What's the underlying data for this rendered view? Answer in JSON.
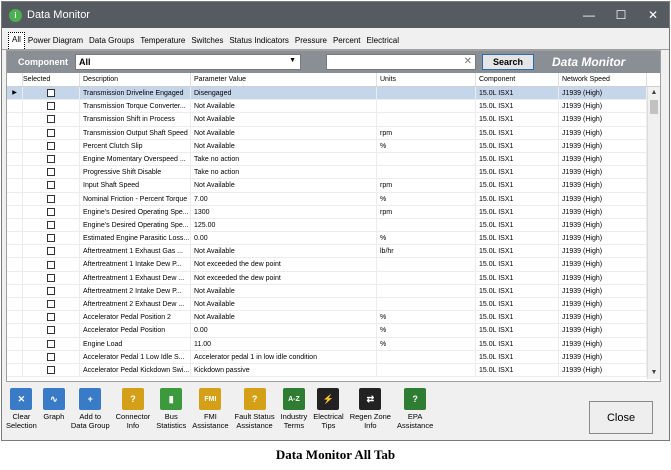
{
  "window": {
    "title": "Data Monitor",
    "icon_letter": "i"
  },
  "titlebar": {
    "minimize": "—",
    "maximize": "☐",
    "close": "✕"
  },
  "tabs": [
    "All",
    "Power Diagram",
    "Data Groups",
    "Temperature",
    "Switches",
    "Status Indicators",
    "Pressure",
    "Percent",
    "Electrical"
  ],
  "filter": {
    "component_label": "Component",
    "component_value": "All",
    "search_value": "",
    "search_button": "Search",
    "brand": "Data Monitor"
  },
  "columns": [
    "Selected",
    "Description",
    "Parameter Value",
    "Units",
    "Component",
    "Network Speed"
  ],
  "rows": [
    {
      "desc": "Transmission Driveline Engaged",
      "value": "Disengaged",
      "units": "",
      "comp": "15.0L ISX1",
      "net": "J1939 (High)",
      "selected": true
    },
    {
      "desc": "Transmission Torque Converter...",
      "value": "Not Available",
      "units": "",
      "comp": "15.0L ISX1",
      "net": "J1939 (High)"
    },
    {
      "desc": "Transmission Shift in Process",
      "value": "Not Available",
      "units": "",
      "comp": "15.0L ISX1",
      "net": "J1939 (High)"
    },
    {
      "desc": "Transmission Output Shaft Speed",
      "value": "Not Available",
      "units": "rpm",
      "comp": "15.0L ISX1",
      "net": "J1939 (High)"
    },
    {
      "desc": "Percent Clutch Slip",
      "value": "Not Available",
      "units": "%",
      "comp": "15.0L ISX1",
      "net": "J1939 (High)"
    },
    {
      "desc": "Engine Momentary Overspeed ...",
      "value": "Take no action",
      "units": "",
      "comp": "15.0L ISX1",
      "net": "J1939 (High)"
    },
    {
      "desc": "Progressive Shift Disable",
      "value": "Take no action",
      "units": "",
      "comp": "15.0L ISX1",
      "net": "J1939 (High)"
    },
    {
      "desc": "Input Shaft Speed",
      "value": "Not Available",
      "units": "rpm",
      "comp": "15.0L ISX1",
      "net": "J1939 (High)"
    },
    {
      "desc": "Nominal Friction - Percent Torque",
      "value": "7.00",
      "units": "%",
      "comp": "15.0L ISX1",
      "net": "J1939 (High)"
    },
    {
      "desc": "Engine's Desired Operating Spe...",
      "value": "1300",
      "units": "rpm",
      "comp": "15.0L ISX1",
      "net": "J1939 (High)"
    },
    {
      "desc": "Engine's Desired Operating Spe...",
      "value": "125.00",
      "units": "",
      "comp": "15.0L ISX1",
      "net": "J1939 (High)"
    },
    {
      "desc": "Estimated Engine Parasitic Loss...",
      "value": "0.00",
      "units": "%",
      "comp": "15.0L ISX1",
      "net": "J1939 (High)"
    },
    {
      "desc": "Aftertreatment 1 Exhaust Gas ...",
      "value": "Not Available",
      "units": "lb/hr",
      "comp": "15.0L ISX1",
      "net": "J1939 (High)"
    },
    {
      "desc": "Aftertreatment 1 Intake Dew P...",
      "value": "Not exceeded the dew point",
      "units": "",
      "comp": "15.0L ISX1",
      "net": "J1939 (High)"
    },
    {
      "desc": "Aftertreatment 1 Exhaust Dew ...",
      "value": "Not exceeded the dew point",
      "units": "",
      "comp": "15.0L ISX1",
      "net": "J1939 (High)"
    },
    {
      "desc": "Aftertreatment 2 Intake Dew P...",
      "value": "Not Available",
      "units": "",
      "comp": "15.0L ISX1",
      "net": "J1939 (High)"
    },
    {
      "desc": "Aftertreatment 2 Exhaust Dew ...",
      "value": "Not Available",
      "units": "",
      "comp": "15.0L ISX1",
      "net": "J1939 (High)"
    },
    {
      "desc": "Accelerator Pedal Position 2",
      "value": "Not Available",
      "units": "%",
      "comp": "15.0L ISX1",
      "net": "J1939 (High)"
    },
    {
      "desc": "Accelerator Pedal Position",
      "value": "0.00",
      "units": "%",
      "comp": "15.0L ISX1",
      "net": "J1939 (High)"
    },
    {
      "desc": "Engine Load",
      "value": "11.00",
      "units": "%",
      "comp": "15.0L ISX1",
      "net": "J1939 (High)"
    },
    {
      "desc": "Accelerator Pedal 1 Low Idle S...",
      "value": "Accelerator pedal 1 in low idle condition",
      "units": "",
      "comp": "15.0L ISX1",
      "net": "J1939 (High)"
    },
    {
      "desc": "Accelerator Pedal Kickdown Swi...",
      "value": "Kickdown passive",
      "units": "",
      "comp": "15.0L ISX1",
      "net": "J1939 (High)"
    }
  ],
  "tools": [
    {
      "name": "clear-selection-button",
      "label": "Clear\nSelection",
      "icon": "clear-selection-icon",
      "color": "#3a7bc8",
      "glyph": "✕"
    },
    {
      "name": "graph-button",
      "label": "Graph",
      "icon": "graph-icon",
      "color": "#3a7bc8",
      "glyph": "∿"
    },
    {
      "name": "add-to-data-group-button",
      "label": "Add to\nData Group",
      "icon": "add-icon",
      "color": "#3a7bc8",
      "glyph": "+"
    },
    {
      "name": "connector-info-button",
      "label": "Connector\nInfo",
      "icon": "connector-info-icon",
      "color": "#d4a017",
      "glyph": "?"
    },
    {
      "name": "bus-statistics-button",
      "label": "Bus\nStatistics",
      "icon": "bus-statistics-icon",
      "color": "#3c9a3c",
      "glyph": "▮"
    },
    {
      "name": "fmi-assistance-button",
      "label": "FMI\nAssistance",
      "icon": "fmi-icon",
      "color": "#d4a017",
      "glyph": "FMI"
    },
    {
      "name": "fault-status-assistance-button",
      "label": "Fault Status\nAssistance",
      "icon": "fault-status-icon",
      "color": "#d4a017",
      "glyph": "?"
    },
    {
      "name": "industry-terms-button",
      "label": "Industry\nTerms",
      "icon": "industry-terms-icon",
      "color": "#2e7d32",
      "glyph": "A-Z"
    },
    {
      "name": "electrical-tips-button",
      "label": "Electrical\nTips",
      "icon": "electrical-tips-icon",
      "color": "#222222",
      "glyph": "⚡"
    },
    {
      "name": "regen-zone-info-button",
      "label": "Regen Zone\nInfo",
      "icon": "regen-zone-icon",
      "color": "#222222",
      "glyph": "⇄"
    },
    {
      "name": "epa-assistance-button",
      "label": "EPA\nAssistance",
      "icon": "epa-icon",
      "color": "#2e7d32",
      "glyph": "?"
    }
  ],
  "close_label": "Close",
  "caption": "Data Monitor All Tab"
}
